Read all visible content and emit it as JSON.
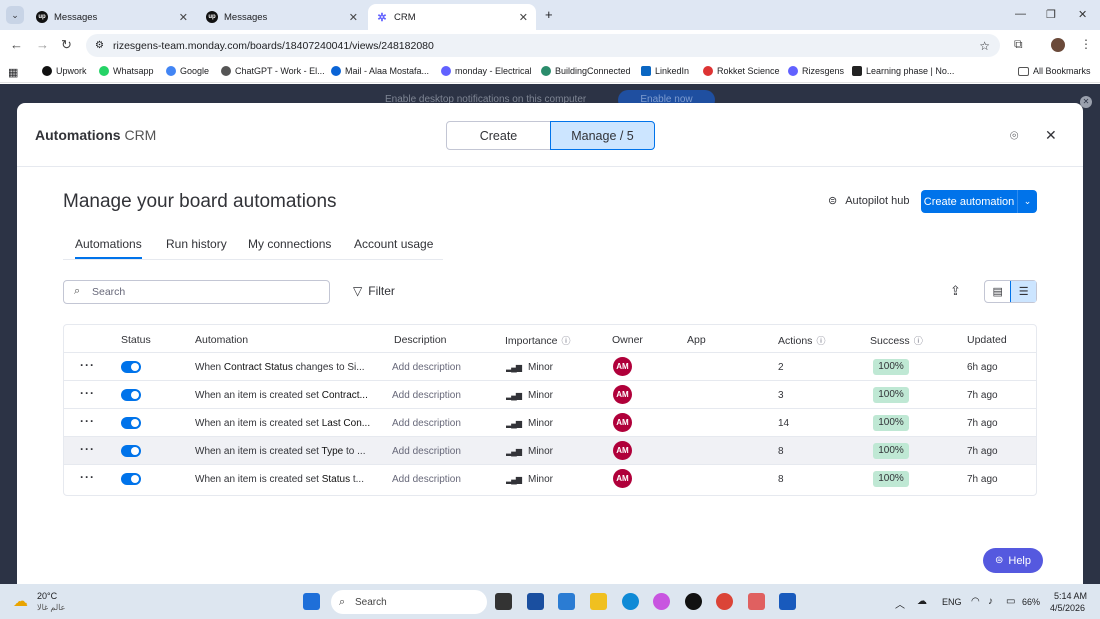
{
  "browser": {
    "tabs": [
      {
        "title": "Messages",
        "favicon": "upwork-icon"
      },
      {
        "title": "Messages",
        "favicon": "upwork-icon"
      },
      {
        "title": "CRM",
        "favicon": "monday-icon"
      }
    ],
    "new_tab": "+",
    "url": "rizesgens-team.monday.com/boards/18407240041/views/248182080",
    "bookmarks": [
      "Upwork",
      "Whatsapp",
      "Google",
      "ChatGPT - Work - El...",
      "Mail - Alaa Mostafa...",
      "monday - Electrical",
      "BuildingConnected",
      "LinkedIn",
      "Rokket Science",
      "Rizesgens",
      "Learning phase | No..."
    ],
    "all_bookmarks": "All Bookmarks"
  },
  "notification": {
    "text": "Enable desktop notifications on this computer",
    "button": "Enable now"
  },
  "modal": {
    "title": "Automations",
    "board": "CRM",
    "segments": {
      "create": "Create",
      "manage": "Manage / 5"
    },
    "heading": "Manage your board automations",
    "autopilot": "Autopilot hub",
    "create_automation": "Create automation",
    "subtabs": [
      "Automations",
      "Run history",
      "My connections",
      "Account usage"
    ],
    "search_placeholder": "Search",
    "filter": "Filter",
    "columns": {
      "status": "Status",
      "automation": "Automation",
      "description": "Description",
      "importance": "Importance",
      "owner": "Owner",
      "app": "App",
      "actions": "Actions",
      "success": "Success",
      "updated": "Updated"
    },
    "rows": [
      {
        "pre": "When ",
        "b1": "Contract Status",
        "mid": " changes to ",
        "b2": "Si...",
        "description": "Add description",
        "importance": "Minor",
        "owner": "AM",
        "actions": "2",
        "success": "100%",
        "updated": "6h ago"
      },
      {
        "pre": "When an item is created set ",
        "b1": "Contract...",
        "mid": "",
        "b2": "",
        "description": "Add description",
        "importance": "Minor",
        "owner": "AM",
        "actions": "3",
        "success": "100%",
        "updated": "7h ago"
      },
      {
        "pre": "When an item is created set ",
        "b1": "Last Con...",
        "mid": "",
        "b2": "",
        "description": "Add description",
        "importance": "Minor",
        "owner": "AM",
        "actions": "14",
        "success": "100%",
        "updated": "7h ago"
      },
      {
        "pre": "When an item is created set ",
        "b1": "Type",
        "mid": " to ...",
        "b2": "",
        "description": "Add description",
        "importance": "Minor",
        "owner": "AM",
        "actions": "8",
        "success": "100%",
        "updated": "7h ago"
      },
      {
        "pre": "When an item is created set ",
        "b1": "Status",
        "mid": " t...",
        "b2": "",
        "description": "Add description",
        "importance": "Minor",
        "owner": "AM",
        "actions": "8",
        "success": "100%",
        "updated": "7h ago"
      }
    ],
    "help": "Help"
  },
  "taskbar": {
    "weather_temp": "20°C",
    "weather_text": "عالم غالا",
    "search": "Search",
    "lang": "ENG",
    "battery": "66%",
    "time": "5:14 AM",
    "date": "4/5/2026"
  },
  "colors": {
    "accent": "#0073ea",
    "success": "#bfe8d4",
    "avatar": "#b0003a",
    "help": "#5559df"
  }
}
